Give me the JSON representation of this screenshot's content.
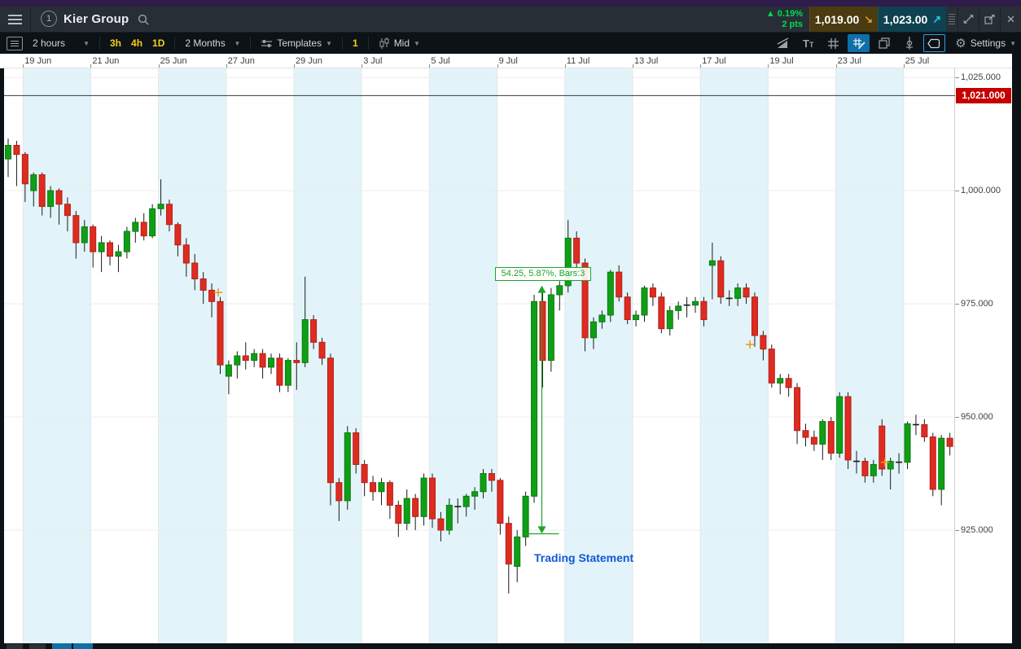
{
  "header": {
    "panel_number": "1",
    "instrument": "Kier Group",
    "change_arrow": "▲",
    "change_pct": "0.19%",
    "change_pts": "2 pts",
    "sell_price": "1,019.00",
    "sell_arrow": "↘",
    "buy_price": "1,023.00",
    "buy_arrow": "↗",
    "close_glyph": "×"
  },
  "toolbar": {
    "interval": "2 hours",
    "quick_intervals": [
      "3h",
      "4h",
      "1D"
    ],
    "range": "2 Months",
    "templates_label": "Templates",
    "count_badge": "1",
    "price_type": "Mid",
    "settings_label": "Settings",
    "caret": "▼"
  },
  "chart": {
    "date_labels": [
      "19 Jun",
      "21 Jun",
      "25 Jun",
      "27 Jun",
      "29 Jun",
      "3 Jul",
      "5 Jul",
      "9 Jul",
      "11 Jul",
      "13 Jul",
      "17 Jul",
      "19 Jul",
      "23 Jul",
      "25 Jul"
    ],
    "price_labels": [
      "1,025.000",
      "1,000.000",
      "975.000",
      "950.000",
      "925.000"
    ],
    "current_price_label": "1,021.000",
    "annotation_text": "54.25, 5.87%, Bars:3",
    "news_label": "Trading Statement"
  },
  "chart_data": {
    "type": "candlestick",
    "title": "Kier Group",
    "interval": "2 hours",
    "range": "2 Months",
    "x_date_labels": [
      "19 Jun",
      "21 Jun",
      "25 Jun",
      "27 Jun",
      "29 Jun",
      "3 Jul",
      "5 Jul",
      "9 Jul",
      "11 Jul",
      "13 Jul",
      "17 Jul",
      "19 Jul",
      "23 Jul",
      "25 Jul"
    ],
    "y_ticks": [
      1025,
      1000,
      975,
      950,
      925
    ],
    "ylim": [
      900,
      1027
    ],
    "current_price": 1021,
    "colors": {
      "up": "#0f9f16",
      "down": "#e02b20",
      "band": "#e2f4f9",
      "current_line": "#3a3a3a",
      "annotation": "#1fa32b",
      "news": "#1259d6",
      "marker": "#f5991e",
      "badge": "#c40000"
    },
    "annotation": {
      "text": "54.25, 5.87%, Bars:3",
      "measured_move": 54.25,
      "measured_pct": "5.87%",
      "bars": 3
    },
    "news_event": {
      "label": "Trading Statement"
    },
    "markers": [
      {
        "x": 268,
        "price": 977.5
      },
      {
        "x": 921,
        "price": 966
      },
      {
        "x": 1087,
        "price": 940
      }
    ],
    "candles": [
      [
        1007,
        1011.5,
        1003,
        1010
      ],
      [
        1010,
        1011,
        1001,
        1008
      ],
      [
        1008,
        1008.5,
        997.5,
        1001.5
      ],
      [
        1000,
        1004,
        996.5,
        1003.5
      ],
      [
        1003.5,
        1004,
        994.5,
        996.5
      ],
      [
        996.5,
        1001,
        994,
        1000
      ],
      [
        1000,
        1000.5,
        992.5,
        997
      ],
      [
        997,
        998.5,
        991,
        994.5
      ],
      [
        994.5,
        995.5,
        985,
        988.5
      ],
      [
        988.5,
        993.5,
        986.5,
        992
      ],
      [
        992,
        992.5,
        983,
        986.5
      ],
      [
        986.5,
        990,
        982,
        988.5
      ],
      [
        988.5,
        989,
        983.5,
        985.5
      ],
      [
        985.5,
        988,
        982,
        986.5
      ],
      [
        986.5,
        992,
        985,
        991
      ],
      [
        991,
        994,
        988.5,
        993
      ],
      [
        993,
        995,
        989,
        990
      ],
      [
        990,
        997,
        989.5,
        996
      ],
      [
        996,
        1002.5,
        994.5,
        997
      ],
      [
        997,
        998,
        991,
        992.5
      ],
      [
        992.5,
        993,
        985.5,
        988
      ],
      [
        988,
        989.5,
        981,
        984
      ],
      [
        984,
        986,
        978,
        980.5
      ],
      [
        980.5,
        982,
        975,
        978
      ],
      [
        978,
        979.5,
        972,
        975.5
      ],
      [
        975.5,
        976.5,
        959.5,
        961.5
      ],
      [
        959,
        962.5,
        955,
        961.5
      ],
      [
        961.5,
        964.5,
        958.5,
        963.5
      ],
      [
        963.5,
        966.5,
        960.5,
        962.5
      ],
      [
        962.5,
        965,
        961,
        964
      ],
      [
        964,
        965,
        958.5,
        961
      ],
      [
        961,
        964,
        959.5,
        963
      ],
      [
        963,
        964,
        955.5,
        957
      ],
      [
        957,
        963,
        955.5,
        962.5
      ],
      [
        962.5,
        966.5,
        956,
        962
      ],
      [
        962,
        981,
        961,
        971.5
      ],
      [
        971.5,
        972.5,
        965,
        966.5
      ],
      [
        966.5,
        967.5,
        961.5,
        963
      ],
      [
        963,
        964,
        930.5,
        935.5
      ],
      [
        935.5,
        936.5,
        927,
        931.5
      ],
      [
        931.5,
        948,
        929.5,
        946.5
      ],
      [
        946.5,
        947.5,
        937.5,
        939.5
      ],
      [
        939.5,
        940.5,
        932.5,
        935.5
      ],
      [
        935.5,
        937,
        931.5,
        933.5
      ],
      [
        933.5,
        936.5,
        930.5,
        935.5
      ],
      [
        935.5,
        936,
        927.5,
        930.5
      ],
      [
        930.5,
        931.5,
        923.5,
        926.5
      ],
      [
        926.5,
        934,
        925,
        932
      ],
      [
        932,
        933,
        925,
        928
      ],
      [
        928,
        937.5,
        926,
        936.5
      ],
      [
        936.5,
        937.5,
        925.5,
        927.5
      ],
      [
        927.5,
        929,
        922.5,
        925
      ],
      [
        925,
        932,
        924,
        930.5
      ],
      [
        930.5,
        932,
        926.5,
        930.2
      ],
      [
        930.2,
        933,
        928,
        932.5
      ],
      [
        932.5,
        934.5,
        929.5,
        933.5
      ],
      [
        933.5,
        938.5,
        932,
        937.5
      ],
      [
        937.5,
        938.5,
        933.5,
        936
      ],
      [
        936,
        936.5,
        924,
        926.5
      ],
      [
        926.5,
        928,
        911,
        917.5
      ],
      [
        917,
        925,
        913.5,
        923.5
      ],
      [
        923.5,
        933.5,
        921.5,
        932.5
      ],
      [
        932.5,
        977,
        931,
        975.5
      ],
      [
        975.5,
        977.5,
        956.5,
        962.5
      ],
      [
        962.5,
        978.5,
        960,
        977
      ],
      [
        977,
        980,
        973.5,
        979
      ],
      [
        979,
        993.5,
        977.5,
        989.5
      ],
      [
        989.5,
        991,
        981.5,
        984
      ],
      [
        984,
        985,
        964.5,
        967.5
      ],
      [
        967.5,
        972,
        965,
        971
      ],
      [
        971,
        973.5,
        969.5,
        972.5
      ],
      [
        972.5,
        982.5,
        971,
        982
      ],
      [
        982,
        983.5,
        975.5,
        976.5
      ],
      [
        976.5,
        977.5,
        970.5,
        971.5
      ],
      [
        971.5,
        973.5,
        970,
        972.5
      ],
      [
        972.5,
        979,
        971,
        978.5
      ],
      [
        978.5,
        979.5,
        974.5,
        976.5
      ],
      [
        976.5,
        977.5,
        968.5,
        969.5
      ],
      [
        969.5,
        974.5,
        968,
        973.5
      ],
      [
        973.5,
        975.5,
        971.5,
        974.5
      ],
      [
        974.5,
        976.5,
        972,
        974.7
      ],
      [
        974.7,
        976.5,
        973,
        975.5
      ],
      [
        975.5,
        976.5,
        970,
        971.5
      ],
      [
        983.5,
        988.5,
        976,
        984.5
      ],
      [
        984.5,
        985.5,
        975,
        976.5
      ],
      [
        976.5,
        978,
        974.5,
        976.2
      ],
      [
        976.2,
        979.5,
        974.5,
        978.5
      ],
      [
        978.5,
        979.5,
        975,
        976.5
      ],
      [
        976.5,
        977.5,
        965.5,
        968
      ],
      [
        968,
        969,
        962.5,
        965
      ],
      [
        965,
        966,
        956.5,
        957.5
      ],
      [
        957.5,
        959.5,
        955,
        958.5
      ],
      [
        958.5,
        959.5,
        954.5,
        956.5
      ],
      [
        956.5,
        957.5,
        944,
        947
      ],
      [
        947,
        948.5,
        943.5,
        945.5
      ],
      [
        945.5,
        947,
        942.5,
        944
      ],
      [
        944,
        949.5,
        940.5,
        949
      ],
      [
        949,
        950,
        940.5,
        942
      ],
      [
        942,
        955.5,
        941,
        954.5
      ],
      [
        954.5,
        955.5,
        938.5,
        940.5
      ],
      [
        940.5,
        942.5,
        937.5,
        940.2
      ],
      [
        940.2,
        941,
        935.5,
        937
      ],
      [
        937,
        940.5,
        935.5,
        939.5
      ],
      [
        948,
        949.5,
        937,
        938.5
      ],
      [
        938.5,
        941,
        934,
        940.2
      ],
      [
        940.2,
        942,
        937.5,
        940
      ],
      [
        940,
        949,
        938.5,
        948.5
      ],
      [
        948.5,
        950.5,
        946,
        948.3
      ],
      [
        948.3,
        949.5,
        944.5,
        945.6
      ],
      [
        945.6,
        946.5,
        932.5,
        934
      ],
      [
        934,
        946,
        930.5,
        945.3
      ],
      [
        945.3,
        946.5,
        941.5,
        943.5
      ]
    ]
  }
}
